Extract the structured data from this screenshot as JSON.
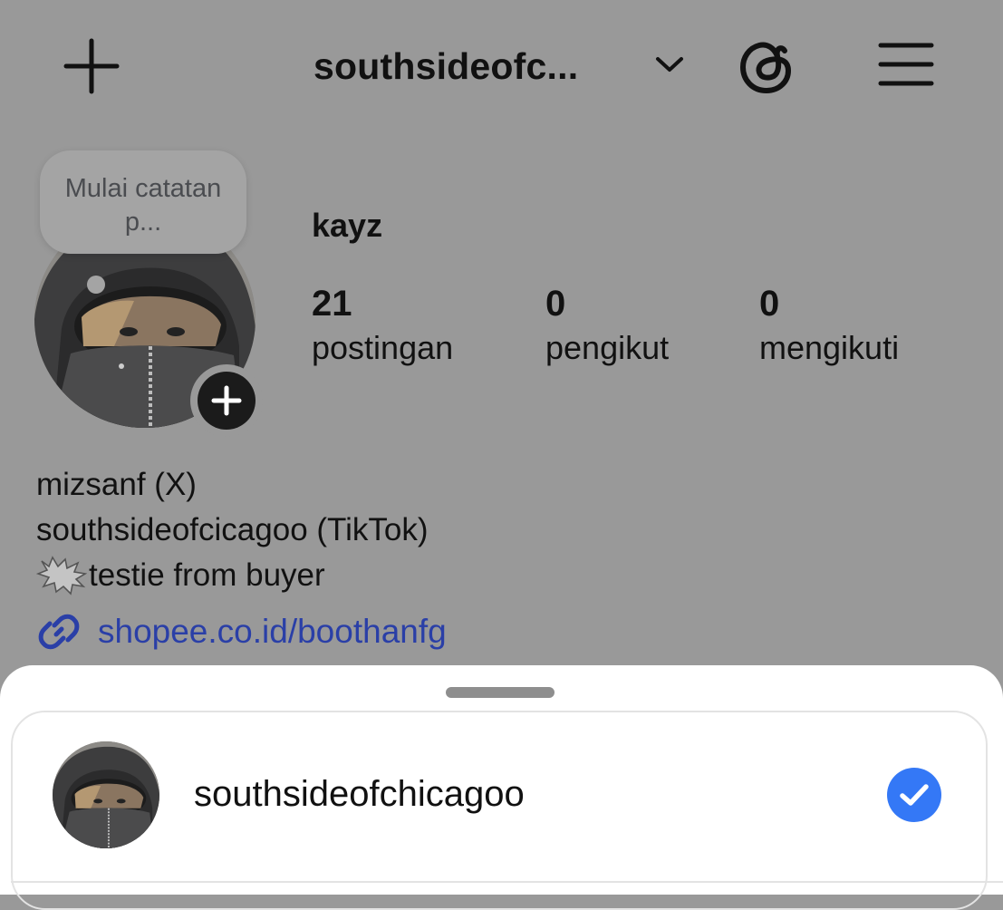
{
  "header": {
    "username": "southsideofc...",
    "icons": [
      "plus-icon",
      "chevron-down-icon",
      "threads-icon",
      "menu-icon"
    ]
  },
  "profile": {
    "note_placeholder": "Mulai catatan p...",
    "display_name": "kayz",
    "stats": [
      {
        "value": "21",
        "label": "postingan"
      },
      {
        "value": "0",
        "label": "pengikut"
      },
      {
        "value": "0",
        "label": "mengikuti"
      }
    ],
    "bio": [
      "mizsanf (X)",
      "southsideofcicagoo (TikTok)",
      "testie from buyer"
    ],
    "link": "shopee.co.id/boothanfg"
  },
  "account_switcher": {
    "accounts": [
      {
        "username": "southsideofchicagoo",
        "selected": true
      }
    ],
    "accent_color": "#3478F6"
  }
}
